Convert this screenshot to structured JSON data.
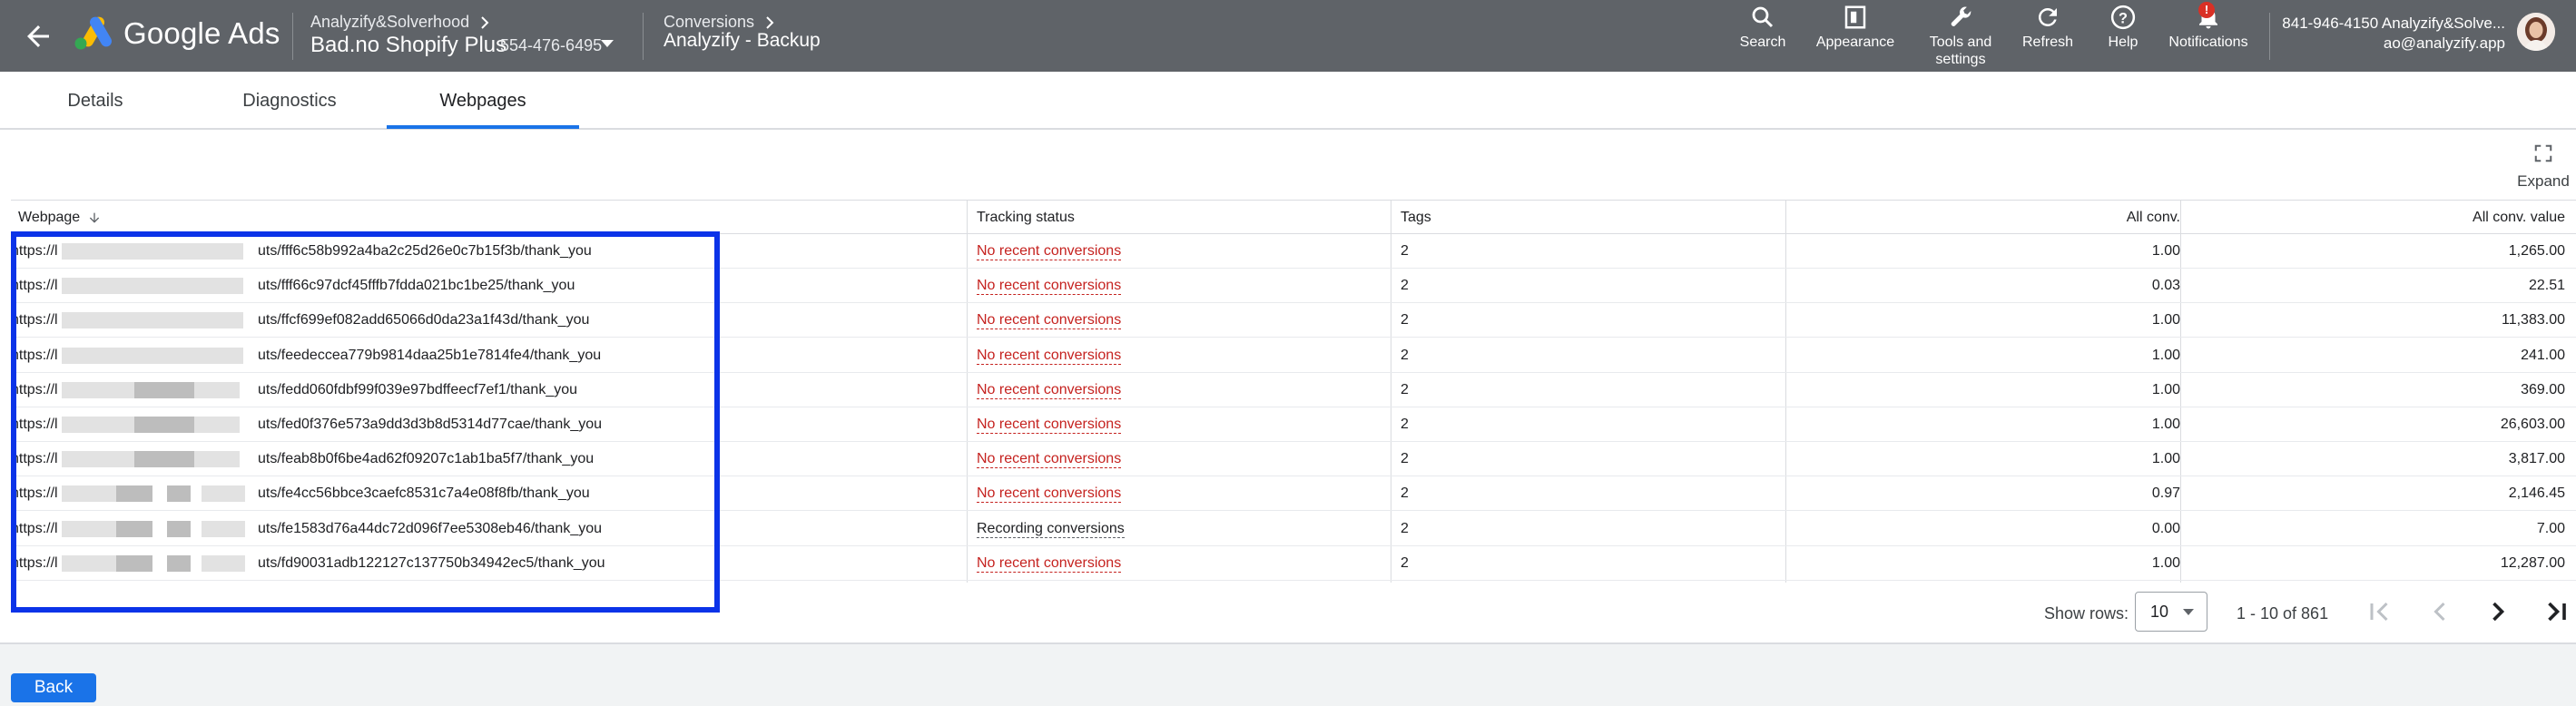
{
  "header": {
    "brand": "Google Ads",
    "account_crumb": "Analyzify&Solverhood",
    "account_name": "Bad.no Shopify Plus",
    "account_id": "554-476-6495",
    "page_crumb": "Conversions",
    "page_name": "Analyzify - Backup",
    "tools": [
      {
        "label": "Search",
        "icon": "search-icon"
      },
      {
        "label": "Appearance",
        "icon": "appearance-icon"
      },
      {
        "label": "Tools and settings",
        "icon": "wrench-icon"
      },
      {
        "label": "Refresh",
        "icon": "refresh-icon"
      },
      {
        "label": "Help",
        "icon": "help-icon"
      },
      {
        "label": "Notifications",
        "icon": "bell-icon",
        "badge": "!"
      }
    ],
    "user_phone": "841-946-4150 Analyzify&Solve...",
    "user_email": "ao@analyzify.app"
  },
  "tabs": [
    {
      "label": "Details",
      "active": false
    },
    {
      "label": "Diagnostics",
      "active": false
    },
    {
      "label": "Webpages",
      "active": true
    }
  ],
  "expand_label": "Expand",
  "table": {
    "columns": [
      "Webpage",
      "Tracking status",
      "Tags",
      "All conv.",
      "All conv. value"
    ],
    "rows": [
      {
        "prefix": "https://l",
        "suffix": "uts/fff6c58b992a4ba2c25d26e0c7b15f3b/thank_you",
        "status": "No recent conversions",
        "tags": "2",
        "conv": "1.00",
        "value": "1,265.00"
      },
      {
        "prefix": "https://l",
        "suffix": "uts/fff66c97dcf45fffb7fdda021bc1be25/thank_you",
        "status": "No recent conversions",
        "tags": "2",
        "conv": "0.03",
        "value": "22.51"
      },
      {
        "prefix": "https://l",
        "suffix": "uts/ffcf699ef082add65066d0da23a1f43d/thank_you",
        "status": "No recent conversions",
        "tags": "2",
        "conv": "1.00",
        "value": "11,383.00"
      },
      {
        "prefix": "https://l",
        "suffix": "uts/feedeccea779b9814daa25b1e7814fe4/thank_you",
        "status": "No recent conversions",
        "tags": "2",
        "conv": "1.00",
        "value": "241.00"
      },
      {
        "prefix": "https://l",
        "suffix": "uts/fedd060fdbf99f039e97bdffeecf7ef1/thank_you",
        "status": "No recent conversions",
        "tags": "2",
        "conv": "1.00",
        "value": "369.00"
      },
      {
        "prefix": "https://l",
        "suffix": "uts/fed0f376e573a9dd3d3b8d5314d77cae/thank_you",
        "status": "No recent conversions",
        "tags": "2",
        "conv": "1.00",
        "value": "26,603.00"
      },
      {
        "prefix": "https://l",
        "suffix": "uts/feab8b0f6be4ad62f09207c1ab1ba5f7/thank_you",
        "status": "No recent conversions",
        "tags": "2",
        "conv": "1.00",
        "value": "3,817.00"
      },
      {
        "prefix": "https://l",
        "suffix": "uts/fe4cc56bbce3caefc8531c7a4e08f8fb/thank_you",
        "status": "No recent conversions",
        "tags": "2",
        "conv": "0.97",
        "value": "2,146.45"
      },
      {
        "prefix": "https://l",
        "suffix": "uts/fe1583d76a44dc72d096f7ee5308eb46/thank_you",
        "status": "Recording conversions",
        "tags": "2",
        "conv": "0.00",
        "value": "7.00"
      },
      {
        "prefix": "https://l",
        "suffix": "uts/fd90031adb122127c137750b34942ec5/thank_you",
        "status": "No recent conversions",
        "tags": "2",
        "conv": "1.00",
        "value": "12,287.00"
      }
    ]
  },
  "pagination": {
    "show_rows_label": "Show rows:",
    "rows_value": "10",
    "range": "1 - 10 of 861"
  },
  "back_label": "Back",
  "colors": {
    "header_bg": "#5f6368",
    "accent": "#1a73e8",
    "status_red": "#c5221f",
    "highlight": "#0b33e8"
  }
}
